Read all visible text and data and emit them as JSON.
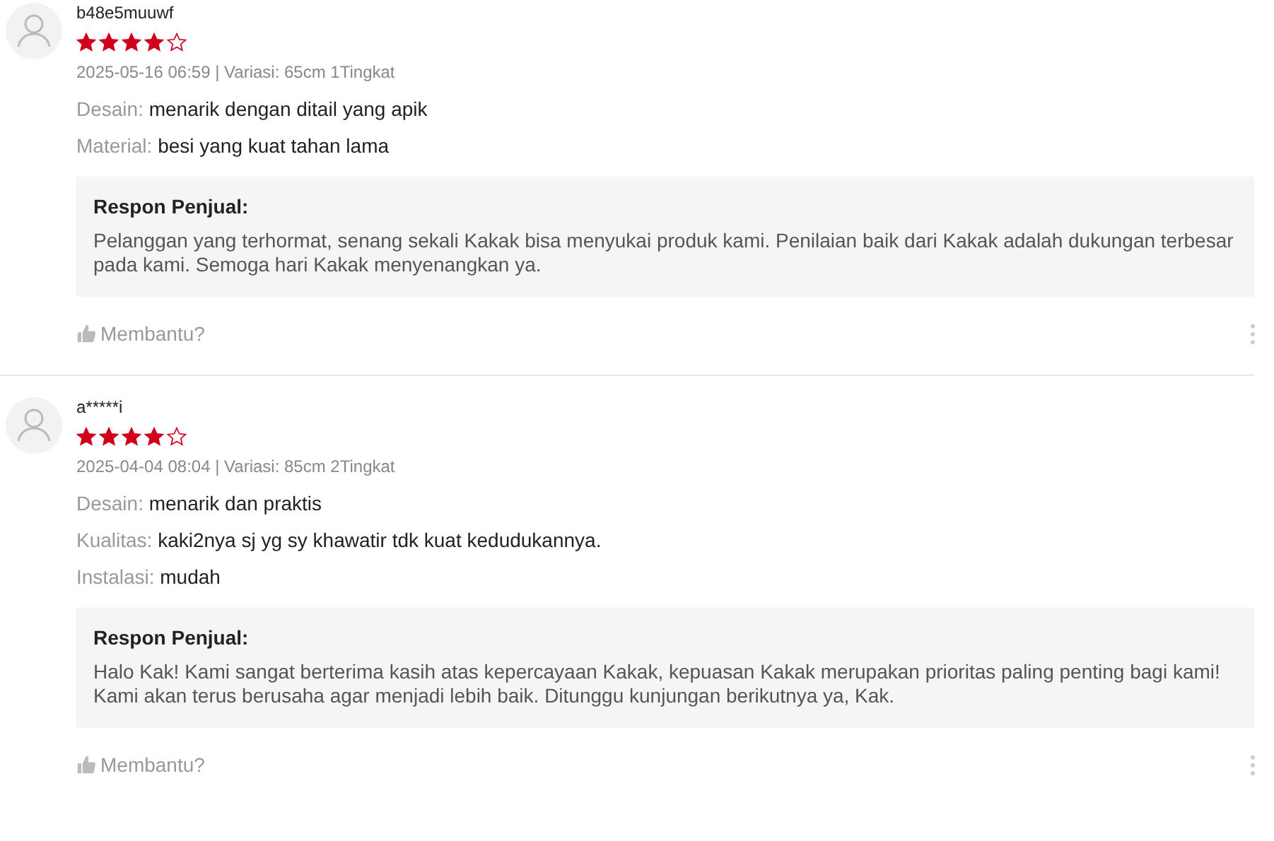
{
  "reviews": [
    {
      "username": "b48e5muuwf",
      "stars": 4,
      "meta": "2025-05-16 06:59 | Variasi: 65cm 1Tingkat",
      "attributes": [
        {
          "label": "Desain:",
          "value": "menarik dengan ditail yang apik"
        },
        {
          "label": "Material:",
          "value": "besi yang kuat tahan lama"
        }
      ],
      "seller_response": {
        "title": "Respon Penjual:",
        "text": "Pelanggan yang terhormat, senang sekali Kakak bisa menyukai produk kami. Penilaian baik dari Kakak adalah dukungan terbesar pada kami. Semoga hari Kakak menyenangkan ya."
      },
      "helpful": "Membantu?"
    },
    {
      "username": "a*****i",
      "stars": 4,
      "meta": "2025-04-04 08:04 | Variasi: 85cm 2Tingkat",
      "attributes": [
        {
          "label": "Desain:",
          "value": "menarik dan praktis"
        },
        {
          "label": "Kualitas:",
          "value": "kaki2nya sj yg sy khawatir tdk kuat kedudukannya."
        },
        {
          "label": "Instalasi:",
          "value": "mudah"
        }
      ],
      "seller_response": {
        "title": "Respon Penjual:",
        "text": "Halo Kak! Kami sangat berterima kasih atas kepercayaan Kakak, kepuasan Kakak merupakan prioritas paling penting bagi kami! Kami akan terus berusaha agar menjadi lebih baik. Ditunggu kunjungan berikutnya ya, Kak."
      },
      "helpful": "Membantu?"
    }
  ]
}
